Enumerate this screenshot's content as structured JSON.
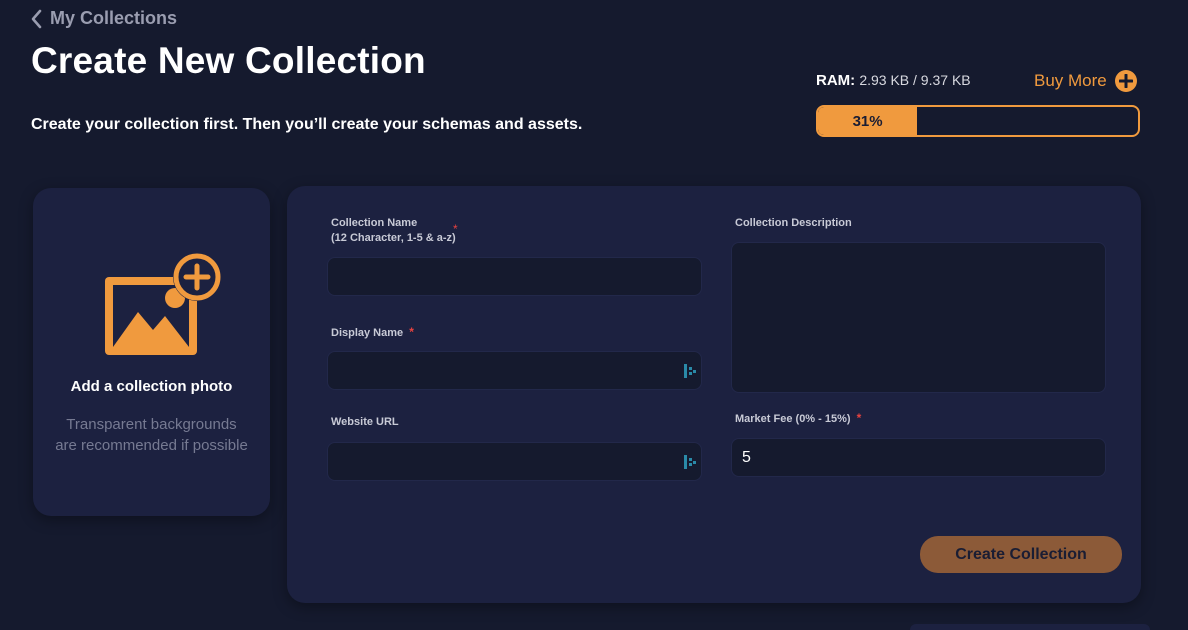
{
  "nav": {
    "back_label": "My Collections"
  },
  "header": {
    "title": "Create New Collection",
    "subtitle": "Create your collection first. Then you’ll create your schemas and assets."
  },
  "ram": {
    "label": "RAM:",
    "value": "2.93 KB / 9.37 KB",
    "buy_more_label": "Buy More",
    "percent_label": "31%",
    "percent": 31
  },
  "photo_upload": {
    "title": "Add a collection photo",
    "hint": "Transparent backgrounds are recommended if possible"
  },
  "form": {
    "collection_name": {
      "label": "Collection Name",
      "sublabel": "(12 Character, 1-5 & a-z)",
      "required_mark": "*",
      "value": ""
    },
    "display_name": {
      "label": "Display Name",
      "required_mark": "*",
      "value": ""
    },
    "website_url": {
      "label": "Website URL",
      "value": ""
    },
    "collection_description": {
      "label": "Collection Description",
      "value": ""
    },
    "market_fee": {
      "label": "Market Fee (0% - 15%)",
      "required_mark": "*",
      "value": "5"
    },
    "submit_label": "Create Collection"
  },
  "colors": {
    "accent": "#f09a3e",
    "background": "#151a2e",
    "card": "#1c2140",
    "required": "#e8423f",
    "button_disabled": "#8c5a38"
  }
}
